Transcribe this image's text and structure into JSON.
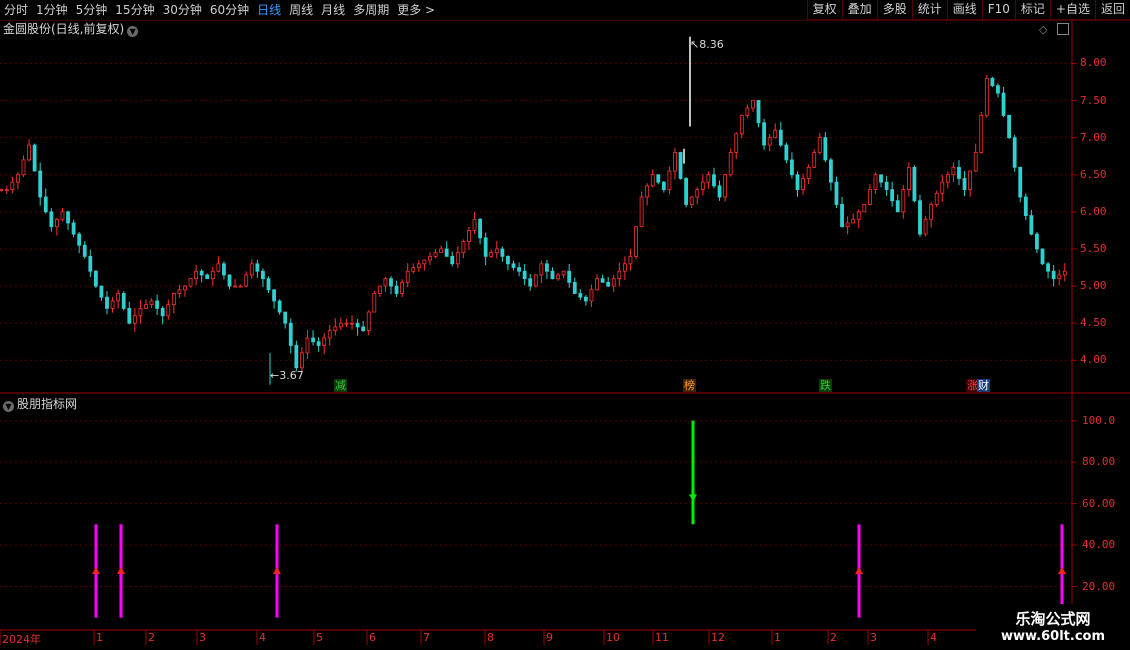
{
  "toolbar": {
    "left_items": [
      "分时",
      "1分钟",
      "5分钟",
      "15分钟",
      "30分钟",
      "60分钟",
      "日线",
      "周线",
      "月线",
      "多周期",
      "更多 >"
    ],
    "active_item": "日线",
    "right_items": [
      "复权",
      "叠加",
      "多股",
      "统计",
      "画线",
      "F10",
      "标记",
      "+自选",
      "返回"
    ]
  },
  "main_chart": {
    "title": "金圆股份(日线,前复权)",
    "y_ticks": [
      "8.00",
      "7.50",
      "7.00",
      "6.50",
      "6.00",
      "5.50",
      "5.00",
      "4.50",
      "4.00"
    ],
    "high_label": "8.36",
    "low_label": "3.67",
    "event_tags": [
      {
        "text": "减",
        "color": "#33cc33",
        "bg": "#0a3a0a"
      },
      {
        "text": "榜",
        "color": "#ff9933",
        "bg": "#3a2200"
      },
      {
        "text": "跌",
        "color": "#33cc33",
        "bg": "#0a3a0a"
      },
      {
        "text": "涨",
        "color": "#ff4444",
        "bg": "#3a0000"
      },
      {
        "text": "财",
        "color": "#ffffff",
        "bg": "#1a3a7a"
      }
    ]
  },
  "indicator_panel": {
    "title": "股朋指标网",
    "y_ticks": [
      "100.0",
      "80.00",
      "60.00",
      "40.00",
      "20.00"
    ]
  },
  "x_axis": {
    "labels": [
      "2024年",
      "1",
      "2",
      "3",
      "4",
      "5",
      "6",
      "7",
      "8",
      "9",
      "10",
      "11",
      "12",
      "1",
      "2",
      "3",
      "4"
    ]
  },
  "watermark": {
    "line1": "乐淘公式网",
    "line2": "www.60lt.com"
  },
  "chart_data": {
    "type": "candlestick",
    "title": "金圆股份(日线,前复权)",
    "ylim": [
      3.6,
      8.45
    ],
    "price_series": [
      6.3,
      6.5,
      6.9,
      6.2,
      5.8,
      6.0,
      5.7,
      5.4,
      5.0,
      4.7,
      4.9,
      4.5,
      4.7,
      4.8,
      4.6,
      4.9,
      5.0,
      5.2,
      5.1,
      5.3,
      5.0,
      5.0,
      5.3,
      5.1,
      4.8,
      4.5,
      3.9,
      4.3,
      4.2,
      4.4,
      4.5,
      4.5,
      4.4,
      4.9,
      5.1,
      4.9,
      5.2,
      5.3,
      5.4,
      5.5,
      5.3,
      5.6,
      5.9,
      5.4,
      5.5,
      5.3,
      5.2,
      5.0,
      5.3,
      5.1,
      5.2,
      4.9,
      4.8,
      5.1,
      5.0,
      5.2,
      5.4,
      6.2,
      6.5,
      6.3,
      6.8,
      6.1,
      6.3,
      6.5,
      6.2,
      6.8,
      7.3,
      7.5,
      6.9,
      7.1,
      6.7,
      6.3,
      6.6,
      7.0,
      6.4,
      5.8,
      5.9,
      6.1,
      6.5,
      6.3,
      6.0,
      6.6,
      5.7,
      6.1,
      6.4,
      6.6,
      6.3,
      6.8,
      7.8,
      7.6,
      7.0,
      6.2,
      5.7,
      5.3,
      5.1,
      5.2
    ],
    "high": 8.36,
    "low": 3.67,
    "indicator": {
      "ylim": [
        0,
        110
      ],
      "signals": [
        {
          "type": "buy",
          "top": 50,
          "bottom": 5
        },
        {
          "type": "buy",
          "top": 50,
          "bottom": 5
        },
        {
          "type": "buy",
          "top": 50,
          "bottom": 5
        },
        {
          "type": "sell",
          "top": 100,
          "bottom": 50
        },
        {
          "type": "buy",
          "top": 50,
          "bottom": 5
        },
        {
          "type": "buy",
          "top": 50,
          "bottom": 5
        }
      ]
    }
  }
}
